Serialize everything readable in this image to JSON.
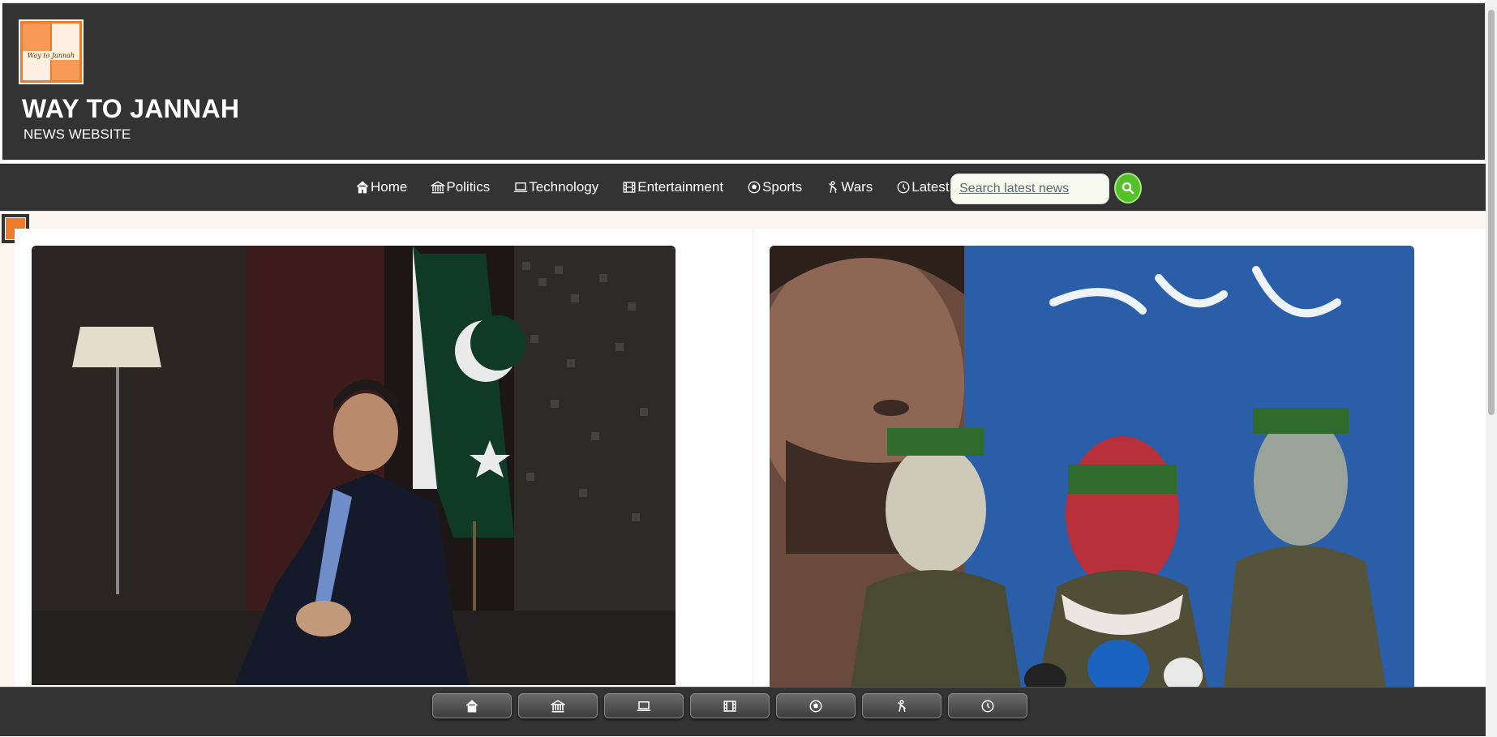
{
  "header": {
    "logo_text": "Way to Jannah",
    "title": "WAY TO JANNAH",
    "subtitle": "NEWS WEBSITE"
  },
  "nav": {
    "items": [
      {
        "label": "Home",
        "icon": "home-icon"
      },
      {
        "label": "Politics",
        "icon": "bank-icon"
      },
      {
        "label": "Technology",
        "icon": "laptop-icon"
      },
      {
        "label": "Entertainment",
        "icon": "film-icon"
      },
      {
        "label": "Sports",
        "icon": "soccer-ball-icon"
      },
      {
        "label": "Wars",
        "icon": "soldier-icon"
      },
      {
        "label": "Latest",
        "icon": "clock-icon"
      }
    ],
    "search_placeholder": "Search latest news",
    "search_icon": "search-icon",
    "accent_color": "#56c02a"
  },
  "bottom_nav": {
    "buttons": [
      "home-icon",
      "bank-icon",
      "laptop-icon",
      "film-icon",
      "soccer-ball-icon",
      "soldier-icon",
      "clock-icon"
    ]
  },
  "colors": {
    "header_bg": "#333333",
    "page_bg": "#fbf6ee"
  }
}
